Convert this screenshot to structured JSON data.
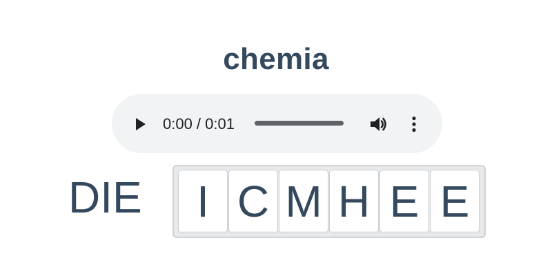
{
  "word": {
    "title": "chemia"
  },
  "audio": {
    "time_display": "0:00 / 0:01",
    "progress": 0.0,
    "icons": {
      "play": "play-icon",
      "volume": "volume-icon",
      "more": "more-vertical-icon"
    }
  },
  "puzzle": {
    "prefix": "DIE",
    "tiles": [
      "I",
      "C",
      "M",
      "H",
      "E",
      "E"
    ]
  },
  "colors": {
    "text": "#34495e",
    "player_background": "#f1f3f4",
    "tile_background": "#ffffff",
    "frame_background": "#e7e9eb"
  }
}
